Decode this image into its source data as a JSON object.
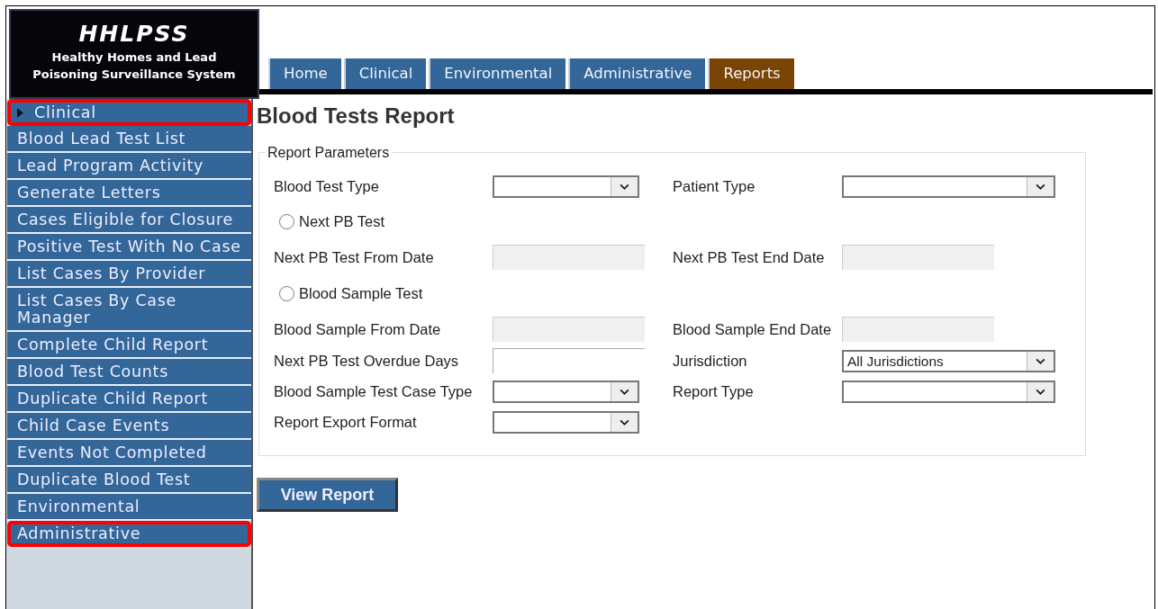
{
  "logo": {
    "title": "HHLPSS",
    "subtitle": "Healthy Homes and Lead Poisoning Surveillance System"
  },
  "tabs": [
    {
      "label": "Home",
      "selected": false
    },
    {
      "label": "Clinical",
      "selected": false
    },
    {
      "label": "Environmental",
      "selected": false
    },
    {
      "label": "Administrative",
      "selected": false
    },
    {
      "label": "Reports",
      "selected": true
    }
  ],
  "sidebar": {
    "items": [
      {
        "label": "Clinical",
        "kind": "section",
        "expanded": true,
        "highlighted": true
      },
      {
        "label": "Blood Lead Test List",
        "kind": "link",
        "highlighted": false
      },
      {
        "label": "Lead Program Activity",
        "kind": "link",
        "highlighted": false
      },
      {
        "label": "Generate Letters",
        "kind": "link",
        "highlighted": false
      },
      {
        "label": "Cases Eligible for Closure",
        "kind": "link",
        "highlighted": false
      },
      {
        "label": "Positive Test With No Case",
        "kind": "link",
        "highlighted": false
      },
      {
        "label": "List Cases By Provider",
        "kind": "link",
        "highlighted": false
      },
      {
        "label": "List Cases By Case Manager",
        "kind": "link",
        "highlighted": false
      },
      {
        "label": "Complete Child Report",
        "kind": "link",
        "highlighted": false
      },
      {
        "label": "Blood Test Counts",
        "kind": "link",
        "highlighted": false
      },
      {
        "label": "Duplicate Child Report",
        "kind": "link",
        "highlighted": false
      },
      {
        "label": "Child Case Events",
        "kind": "link",
        "highlighted": false
      },
      {
        "label": "Events Not Completed",
        "kind": "link",
        "highlighted": false
      },
      {
        "label": "Duplicate Blood Test",
        "kind": "link",
        "highlighted": false
      },
      {
        "label": "Environmental",
        "kind": "section",
        "expanded": false,
        "highlighted": false
      },
      {
        "label": "Administrative",
        "kind": "section",
        "expanded": false,
        "highlighted": true
      }
    ]
  },
  "page_title": "Blood Tests Report",
  "parameters": {
    "legend": "Report Parameters",
    "rows": [
      {
        "kind": "fields",
        "fields": [
          {
            "label": "Blood Test Type",
            "kind": "select",
            "disabled": false
          },
          {
            "label": "Patient Type",
            "kind": "select",
            "disabled": false
          }
        ]
      },
      {
        "kind": "radio",
        "label": "Next PB Test",
        "selected": false
      },
      {
        "kind": "fields",
        "fields": [
          {
            "label": "Next PB Test From Date",
            "kind": "text",
            "disabled": true
          },
          {
            "label": "Next PB Test End Date",
            "kind": "text",
            "disabled": true
          }
        ]
      },
      {
        "kind": "radio",
        "label": "Blood Sample Test",
        "selected": false
      },
      {
        "kind": "fields",
        "fields": [
          {
            "label": "Blood Sample From Date",
            "kind": "text",
            "disabled": true
          },
          {
            "label": "Blood Sample End Date",
            "kind": "text",
            "disabled": true
          }
        ]
      },
      {
        "kind": "fields",
        "fields": [
          {
            "label": "Next PB Test Overdue Days",
            "kind": "text",
            "disabled": false
          },
          {
            "label": "Jurisdiction",
            "kind": "select",
            "disabled": false,
            "value": "All Jurisdictions"
          }
        ]
      },
      {
        "kind": "fields",
        "fields": [
          {
            "label": "Blood Sample Test Case Type",
            "kind": "select",
            "disabled": false
          },
          {
            "label": "Report Type",
            "kind": "select",
            "disabled": false
          }
        ]
      },
      {
        "kind": "fields",
        "fields": [
          {
            "label": "Report Export Format",
            "kind": "select",
            "disabled": false
          }
        ]
      }
    ]
  },
  "view_button": "View Report"
}
